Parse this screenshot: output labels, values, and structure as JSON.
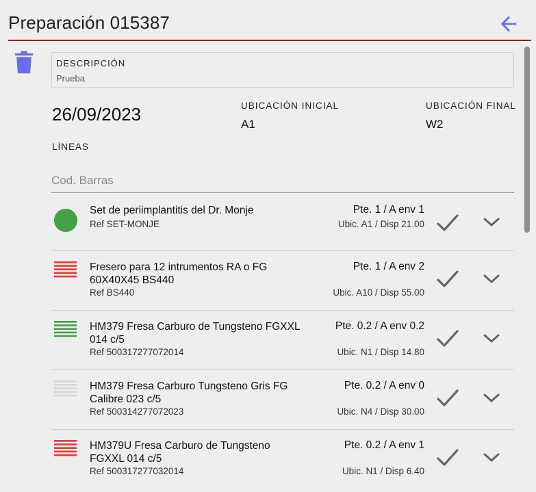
{
  "header": {
    "title": "Preparación 015387"
  },
  "description": {
    "label": "DESCRIPCIÓN",
    "value": "Prueba"
  },
  "info": {
    "date": "26/09/2023",
    "initial_location_label": "UBICACIÓN INICIAL",
    "initial_location": "A1",
    "final_location_label": "UBICACIÓN FINAL",
    "final_location": "W2",
    "lines_label": "LÍNEAS"
  },
  "barcode": {
    "placeholder": "Cod. Barras",
    "value": ""
  },
  "colors": {
    "accent": "#6b6bef",
    "rule": "#a3121a",
    "green": "#43a047",
    "red": "#e53935",
    "grey": "#d8d8d8"
  },
  "lines": [
    {
      "status": "green-dot",
      "name": "Set de periimplantitis del Dr. Monje",
      "ref": "Ref SET-MONJE",
      "qty": "Pte. 1 / A env 1",
      "loc": "Ubic. A1 / Disp 21.00"
    },
    {
      "status": "red-lines",
      "name": "Fresero para 12 intrumentos RA o FG 60X40X45 BS440",
      "ref": "Ref BS440",
      "qty": "Pte. 1 / A env 2",
      "loc": "Ubic. A10 / Disp 55.00"
    },
    {
      "status": "green-lines",
      "name": "HM379 Fresa Carburo de Tungsteno FGXXL 014 c/5",
      "ref": "Ref 500317277072014",
      "qty": "Pte. 0.2 / A env 0.2",
      "loc": "Ubic. N1 / Disp 14.80"
    },
    {
      "status": "grey-lines",
      "name": "HM379 Fresa Carburo Tungsteno Gris FG Calibre 023 c/5",
      "ref": "Ref 500314277072023",
      "qty": "Pte. 0.2 / A env 0",
      "loc": "Ubic. N4 / Disp 30.00"
    },
    {
      "status": "red-lines",
      "name": "HM379U Fresa Carburo de Tungsteno FGXXL 014 c/5",
      "ref": "Ref 500317277032014",
      "qty": "Pte. 0.2 / A env 1",
      "loc": "Ubic. N1 / Disp 6.40"
    }
  ]
}
